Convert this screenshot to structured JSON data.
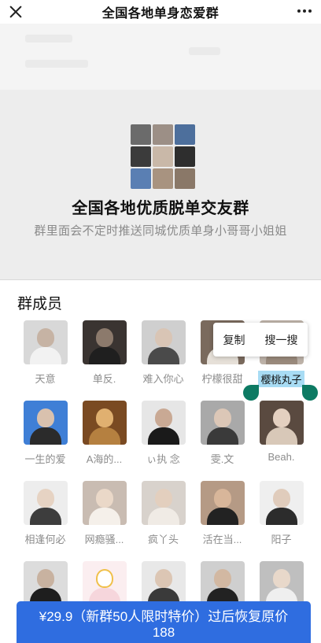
{
  "header": {
    "title": "全国各地单身恋爱群",
    "close_icon": "close-icon",
    "more_icon": "more-dots-icon"
  },
  "group": {
    "name": "全国各地优质脱单交友群",
    "description": "群里面会不定时推送同城优质单身小哥哥小姐姐"
  },
  "members_section": {
    "title": "群成员",
    "members": [
      {
        "name": "天意"
      },
      {
        "name": "单反."
      },
      {
        "name": "难入你心"
      },
      {
        "name": "柠檬很甜"
      },
      {
        "name": "樱桃丸子"
      },
      {
        "name": "一生的爱"
      },
      {
        "name": "A海的..."
      },
      {
        "name": "ぃ执 念"
      },
      {
        "name": "雯.文"
      },
      {
        "name": "Beah."
      },
      {
        "name": "相逢何必"
      },
      {
        "name": "网瘾骚..."
      },
      {
        "name": "疯丫头"
      },
      {
        "name": "活在当..."
      },
      {
        "name": "阳子"
      }
    ]
  },
  "context_menu": {
    "copy_label": "复制",
    "search_label": "搜一搜"
  },
  "cta": {
    "line1": "¥29.9（新群50人限时特价）过后恢复原价",
    "line2": "188"
  },
  "colors": {
    "accent": "#2f6de0",
    "selection": "#a8dcf4",
    "handle": "#0d7a63",
    "hero_bg": "#ededed"
  }
}
